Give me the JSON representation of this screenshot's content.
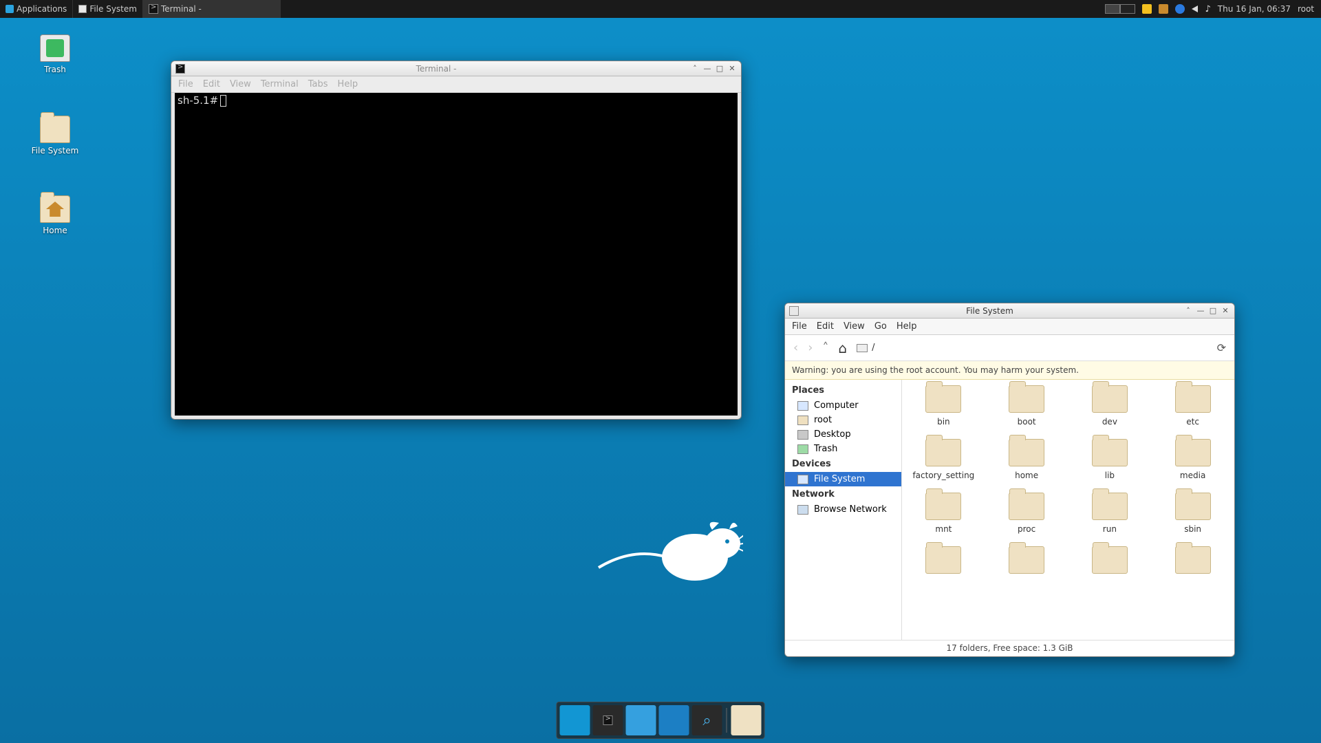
{
  "panel": {
    "applications": "Applications",
    "task_filesystem": "File System",
    "task_terminal": "Terminal -",
    "clock": "Thu 16 Jan, 06:37",
    "user": "root"
  },
  "desktop": {
    "trash": "Trash",
    "filesystem": "File System",
    "home": "Home"
  },
  "terminal": {
    "title": "Terminal -",
    "menu": {
      "file": "File",
      "edit": "Edit",
      "view": "View",
      "terminal": "Terminal",
      "tabs": "Tabs",
      "help": "Help"
    },
    "prompt": "sh-5.1#"
  },
  "fm": {
    "title": "File System",
    "menu": {
      "file": "File",
      "edit": "Edit",
      "view": "View",
      "go": "Go",
      "help": "Help"
    },
    "path": "/",
    "warning": "Warning: you are using the root account. You may harm your system.",
    "sections": {
      "places": "Places",
      "devices": "Devices",
      "network": "Network"
    },
    "places": {
      "computer": "Computer",
      "root": "root",
      "desktop": "Desktop",
      "trash": "Trash"
    },
    "devices": {
      "filesystem": "File System"
    },
    "network": {
      "browse": "Browse Network"
    },
    "folders": [
      "bin",
      "boot",
      "dev",
      "etc",
      "factory_setting",
      "home",
      "lib",
      "media",
      "mnt",
      "proc",
      "run",
      "sbin",
      "",
      "",
      "",
      ""
    ],
    "folders_row4_visible": false,
    "status": "17 folders, Free space: 1.3 GiB"
  }
}
